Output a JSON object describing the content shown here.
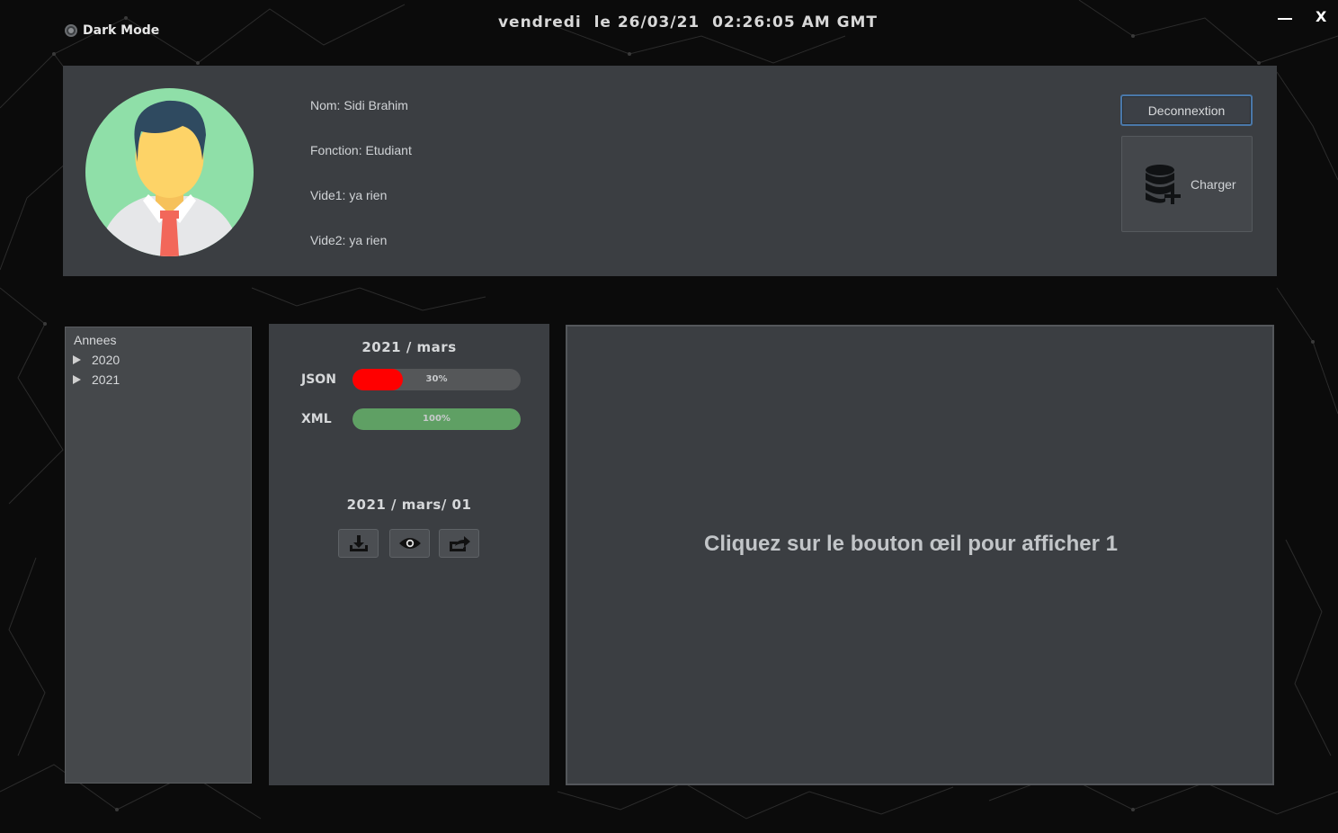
{
  "window": {
    "dark_mode_label": "Dark Mode",
    "clock": "vendredi  le 26/03/21  02:26:05 AM GMT",
    "close_label": "X"
  },
  "profile": {
    "nom": "Nom: Sidi Brahim",
    "fonction": "Fonction: Etudiant",
    "vide1": "Vide1: ya rien",
    "vide2": "Vide2: ya rien",
    "logout_label": "Deconnextion",
    "charger_label": "Charger",
    "charger_icon": "database-add-icon",
    "avatar_icon": "user-avatar-icon"
  },
  "tree": {
    "header": "Annees",
    "items": [
      {
        "label": "2020",
        "icon": "expand-arrow-icon"
      },
      {
        "label": "2021",
        "icon": "expand-arrow-icon"
      }
    ]
  },
  "month_panel": {
    "title": "2021 / mars",
    "progress": [
      {
        "label": "JSON",
        "text": "30%",
        "percent": 30,
        "color": "#ff0000"
      },
      {
        "label": "XML",
        "text": "100%",
        "percent": 100,
        "color": "#5fa064"
      }
    ],
    "day_title": "2021 / mars/ 01",
    "actions": [
      "download-icon",
      "eye-icon",
      "share-icon"
    ]
  },
  "viewer": {
    "message": "Cliquez sur le bouton œil pour afficher 1"
  }
}
